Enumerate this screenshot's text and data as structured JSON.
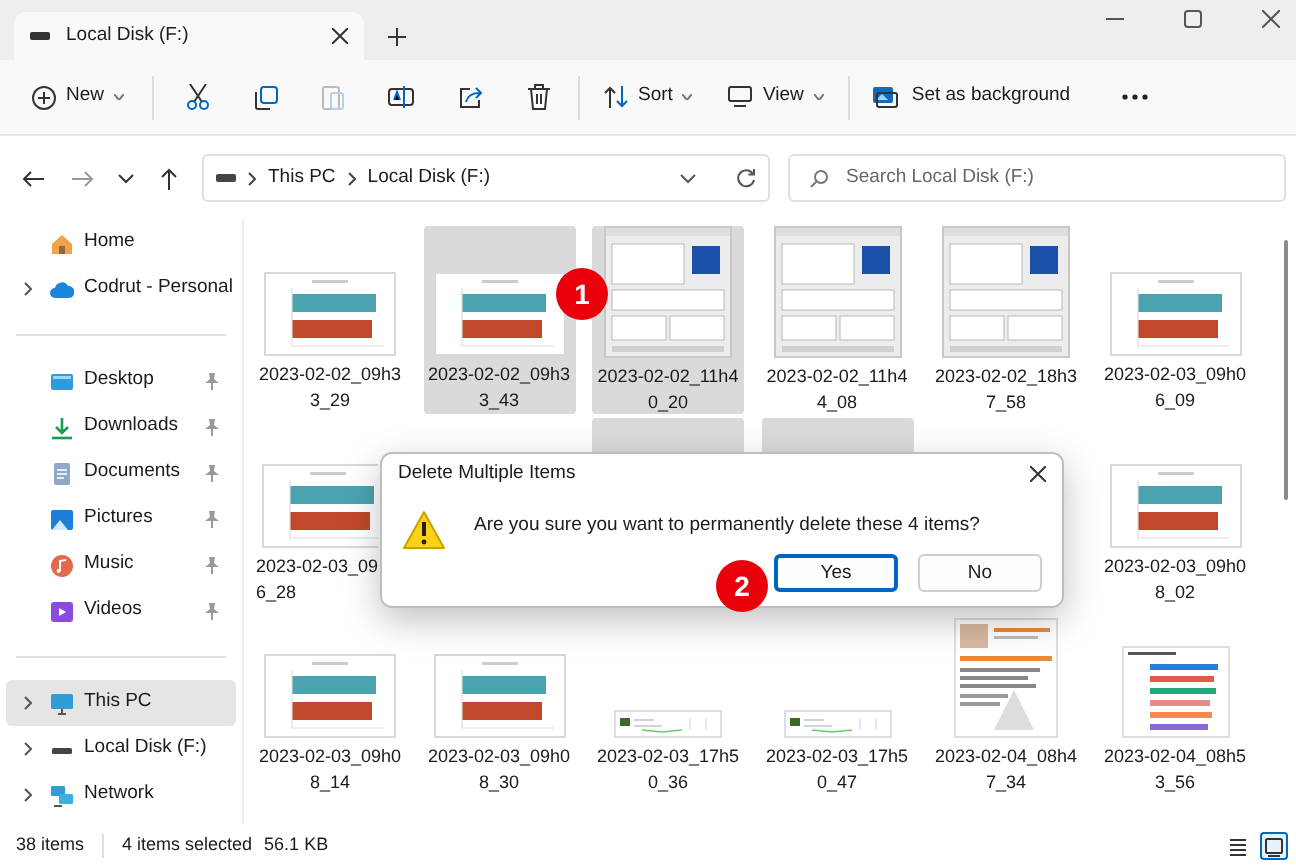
{
  "window": {
    "tab_title": "Local Disk (F:)"
  },
  "toolbar": {
    "new_label": "New",
    "sort_label": "Sort",
    "view_label": "View",
    "background_label": "Set as background"
  },
  "address": {
    "path": [
      "This PC",
      "Local Disk (F:)"
    ],
    "search_placeholder": "Search Local Disk (F:)"
  },
  "sidebar": {
    "groups": [
      [
        {
          "label": "Home",
          "kind": "home",
          "expandable": false,
          "pinned": false,
          "selected": false
        },
        {
          "label": "Codrut - Personal",
          "kind": "cloud",
          "expandable": true,
          "pinned": false,
          "selected": false
        }
      ],
      [
        {
          "label": "Desktop",
          "kind": "desktop",
          "expandable": false,
          "pinned": true,
          "selected": false
        },
        {
          "label": "Downloads",
          "kind": "download",
          "expandable": false,
          "pinned": true,
          "selected": false
        },
        {
          "label": "Documents",
          "kind": "document",
          "expandable": false,
          "pinned": true,
          "selected": false
        },
        {
          "label": "Pictures",
          "kind": "pictures",
          "expandable": false,
          "pinned": true,
          "selected": false
        },
        {
          "label": "Music",
          "kind": "music",
          "expandable": false,
          "pinned": true,
          "selected": false
        },
        {
          "label": "Videos",
          "kind": "videos",
          "expandable": false,
          "pinned": true,
          "selected": false
        }
      ],
      [
        {
          "label": "This PC",
          "kind": "pc",
          "expandable": true,
          "pinned": false,
          "selected": true
        },
        {
          "label": "Local Disk (F:)",
          "kind": "drive",
          "expandable": true,
          "pinned": false,
          "selected": false
        },
        {
          "label": "Network",
          "kind": "network",
          "expandable": true,
          "pinned": false,
          "selected": false
        }
      ]
    ]
  },
  "files": {
    "rows": [
      [
        {
          "label_lines": [
            "2023-02-02_09h3",
            "3_29"
          ],
          "kind": "chart",
          "selected": false
        },
        {
          "label_lines": [
            "2023-02-02_09h3",
            "3_43"
          ],
          "kind": "chart",
          "selected": true
        },
        {
          "label_lines": [
            "2023-02-02_11h4",
            "0_20"
          ],
          "kind": "window",
          "selected": true
        },
        {
          "label_lines": [
            "2023-02-02_11h4",
            "4_08"
          ],
          "kind": "window",
          "selected": false
        },
        {
          "label_lines": [
            "2023-02-02_18h3",
            "7_58"
          ],
          "kind": "window",
          "selected": false
        },
        {
          "label_lines": [
            "2023-02-03_09h0",
            "6_09"
          ],
          "kind": "chart",
          "selected": false
        }
      ],
      [
        {
          "label_lines": [
            "2023-02-03_09",
            "6_28"
          ],
          "kind": "chart",
          "selected": false,
          "cut": true
        },
        null,
        {
          "selected": true
        },
        {
          "selected": true
        },
        null,
        {
          "label_lines": [
            "2023-02-03_09h0",
            "8_02"
          ],
          "kind": "chart",
          "selected": false
        }
      ],
      [
        {
          "label_lines": [
            "2023-02-03_09h0",
            "8_14"
          ],
          "kind": "chart",
          "selected": false
        },
        {
          "label_lines": [
            "2023-02-03_09h0",
            "8_30"
          ],
          "kind": "chart",
          "selected": false
        },
        {
          "label_lines": [
            "2023-02-03_17h5",
            "0_36"
          ],
          "kind": "strip",
          "selected": false
        },
        {
          "label_lines": [
            "2023-02-03_17h5",
            "0_47"
          ],
          "kind": "strip",
          "selected": false
        },
        {
          "label_lines": [
            "2023-02-04_08h4",
            "7_34"
          ],
          "kind": "page",
          "selected": false
        },
        {
          "label_lines": [
            "2023-02-04_08h5",
            "3_56"
          ],
          "kind": "ranking",
          "selected": false
        }
      ]
    ]
  },
  "dialog": {
    "title": "Delete Multiple Items",
    "message": "Are you sure you want to permanently delete these 4 items?",
    "buttons": [
      {
        "label": "Yes",
        "focused": true
      },
      {
        "label": "No",
        "focused": false
      }
    ]
  },
  "callouts": [
    "1",
    "2"
  ],
  "status_bar": {
    "item_count": "38 items",
    "selection": "4 items selected",
    "size": "56.1 KB",
    "views": [
      {
        "kind": "details",
        "selected": false
      },
      {
        "kind": "tiles",
        "selected": true
      }
    ]
  }
}
